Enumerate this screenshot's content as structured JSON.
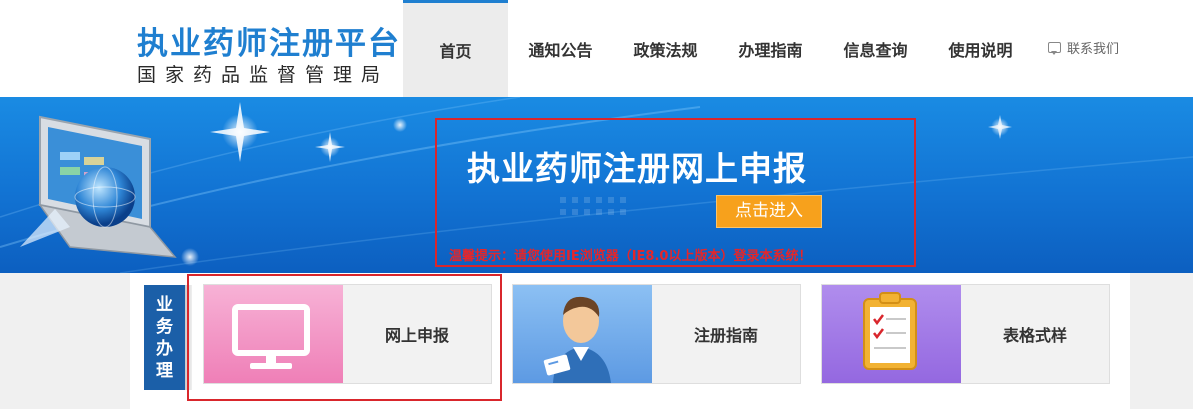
{
  "header": {
    "title": "执业药师注册平台",
    "subtitle": "国家药品监督管理局",
    "nav": [
      {
        "label": "首页",
        "active": true
      },
      {
        "label": "通知公告",
        "active": false
      },
      {
        "label": "政策法规",
        "active": false
      },
      {
        "label": "办理指南",
        "active": false
      },
      {
        "label": "信息查询",
        "active": false
      },
      {
        "label": "使用说明",
        "active": false
      }
    ],
    "contact_label": "联系我们",
    "contact_icon": "message-icon"
  },
  "banner": {
    "title": "执业药师注册网上申报",
    "enter_button": "点击进入",
    "tip": "温馨提示：请您使用IE浏览器（IE8.0以上版本）登录本系统！"
  },
  "business": {
    "label_chars": [
      "业",
      "务",
      "办",
      "理"
    ],
    "cards": [
      {
        "label": "网上申报",
        "icon": "monitor-icon",
        "color": "#f59fcb"
      },
      {
        "label": "注册指南",
        "icon": "person-badge-icon",
        "color": "#7ab0ec"
      },
      {
        "label": "表格式样",
        "icon": "clipboard-checklist-icon",
        "color": "#a47de6"
      }
    ]
  },
  "colors": {
    "brand": "#1f7fd0",
    "highlight": "#d9262c",
    "button": "#f7a11c"
  }
}
